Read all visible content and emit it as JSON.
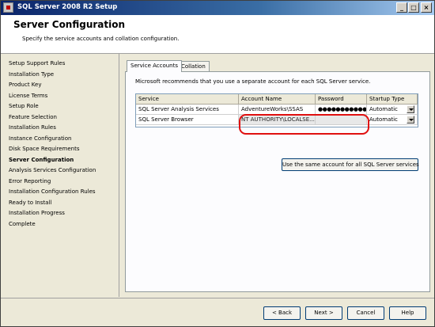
{
  "window": {
    "title": "SQL Server 2008 R2 Setup"
  },
  "header": {
    "title": "Server Configuration",
    "subtitle": "Specify the service accounts and collation configuration."
  },
  "nav": {
    "items": [
      {
        "label": "Setup Support Rules"
      },
      {
        "label": "Installation Type"
      },
      {
        "label": "Product Key"
      },
      {
        "label": "License Terms"
      },
      {
        "label": "Setup Role"
      },
      {
        "label": "Feature Selection"
      },
      {
        "label": "Installation Rules"
      },
      {
        "label": "Instance Configuration"
      },
      {
        "label": "Disk Space Requirements"
      },
      {
        "label": "Server Configuration",
        "current": true
      },
      {
        "label": "Analysis Services Configuration"
      },
      {
        "label": "Error Reporting"
      },
      {
        "label": "Installation Configuration Rules"
      },
      {
        "label": "Ready to Install"
      },
      {
        "label": "Installation Progress"
      },
      {
        "label": "Complete"
      }
    ]
  },
  "tabs": [
    {
      "label": "Service Accounts",
      "active": true
    },
    {
      "label": "Collation",
      "active": false
    }
  ],
  "service_accounts": {
    "intro": "Microsoft recommends that you use a separate account for each SQL Server service.",
    "columns": [
      "Service",
      "Account Name",
      "Password",
      "Startup Type"
    ],
    "rows": [
      {
        "service": "SQL Server Analysis Services",
        "account": "AdventureWorks\\SSAS",
        "password": "●●●●●●●●●●●",
        "startup": "Automatic"
      },
      {
        "service": "SQL Server Browser",
        "account": "NT AUTHORITY\\LOCALSE...",
        "password": "",
        "startup": "Automatic"
      }
    ],
    "same_account_button": "Use the same account for all SQL Server services"
  },
  "footer": {
    "back": "< Back",
    "next": "Next >",
    "cancel": "Cancel",
    "help": "Help"
  },
  "colors": {
    "highlight": "#e01010",
    "titlebar": "#0a246a"
  }
}
